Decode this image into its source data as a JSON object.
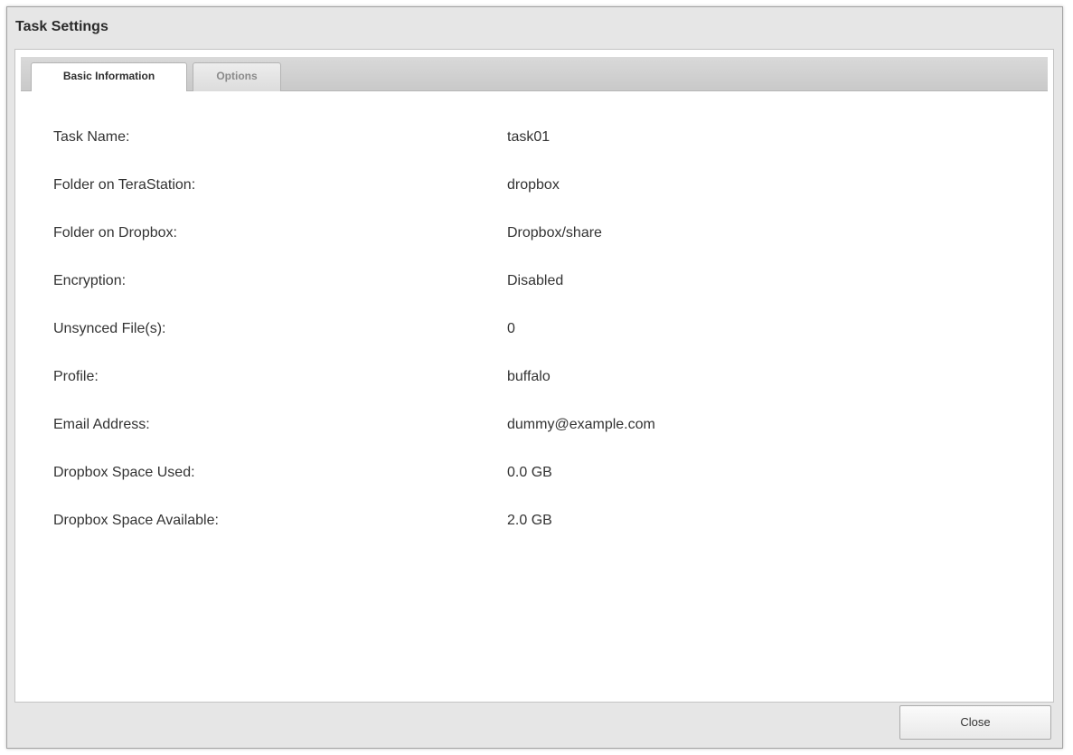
{
  "dialog": {
    "title": "Task Settings",
    "close_label": "Close"
  },
  "tabs": [
    {
      "label": "Basic Information",
      "active": true
    },
    {
      "label": "Options",
      "active": false
    }
  ],
  "fields": [
    {
      "label": "Task Name:",
      "value": "task01"
    },
    {
      "label": "Folder on TeraStation:",
      "value": "dropbox"
    },
    {
      "label": "Folder on Dropbox:",
      "value": "Dropbox/share"
    },
    {
      "label": "Encryption:",
      "value": "Disabled"
    },
    {
      "label": "Unsynced File(s):",
      "value": "0"
    },
    {
      "label": "Profile:",
      "value": "buffalo"
    },
    {
      "label": "Email Address:",
      "value": "dummy@example.com"
    },
    {
      "label": "Dropbox Space Used:",
      "value": "0.0 GB"
    },
    {
      "label": "Dropbox Space Available:",
      "value": "2.0 GB"
    }
  ]
}
